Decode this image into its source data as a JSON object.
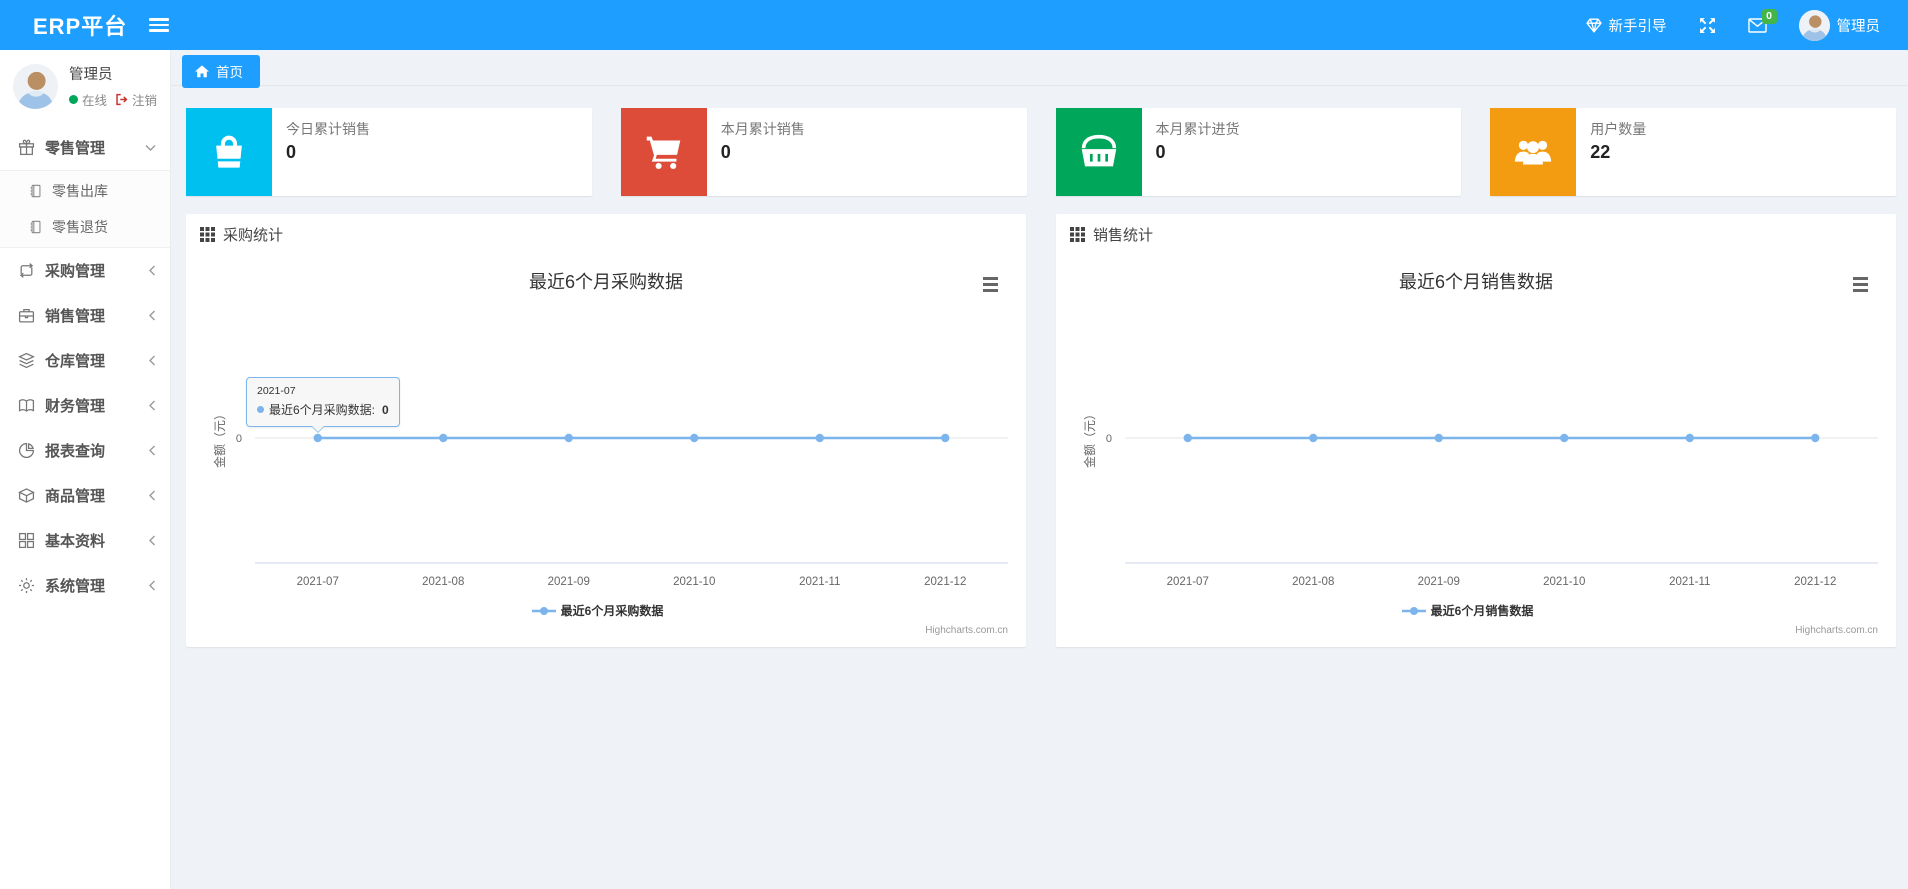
{
  "colors": {
    "accent": "#1e9fff",
    "badge_green": "#44b549",
    "series_blue": "#7cb5ec"
  },
  "navbar": {
    "brand": "ERP平台",
    "guide_label": "新手引导",
    "mail_badge": "0",
    "user_label": "管理员"
  },
  "sidebar": {
    "user": {
      "name": "管理员",
      "status": "在线",
      "logout_label": "注销"
    },
    "items": [
      {
        "label": "零售管理",
        "icon": "gift-icon",
        "expanded": true,
        "children": [
          {
            "label": "零售出库"
          },
          {
            "label": "零售退货"
          }
        ]
      },
      {
        "label": "采购管理",
        "icon": "loop-icon"
      },
      {
        "label": "销售管理",
        "icon": "briefcase-icon"
      },
      {
        "label": "仓库管理",
        "icon": "layers-icon"
      },
      {
        "label": "财务管理",
        "icon": "book-icon"
      },
      {
        "label": "报表查询",
        "icon": "pie-chart-icon"
      },
      {
        "label": "商品管理",
        "icon": "box-icon"
      },
      {
        "label": "基本资料",
        "icon": "grid-icon"
      },
      {
        "label": "系统管理",
        "icon": "gear-icon"
      }
    ]
  },
  "tabs": [
    {
      "label": "首页"
    }
  ],
  "cards": [
    {
      "label": "今日累计销售",
      "value": "0",
      "color": "#00c0ef",
      "icon": "shopping-bag-icon"
    },
    {
      "label": "本月累计销售",
      "value": "0",
      "color": "#dd4b39",
      "icon": "cart-icon"
    },
    {
      "label": "本月累计进货",
      "value": "0",
      "color": "#00a65a",
      "icon": "basket-icon"
    },
    {
      "label": "用户数量",
      "value": "22",
      "color": "#f39c12",
      "icon": "users-icon"
    }
  ],
  "panels": [
    {
      "title": "采购统计"
    },
    {
      "title": "销售统计"
    }
  ],
  "chart_data": [
    {
      "type": "line",
      "title": "最近6个月采购数据",
      "categories": [
        "2021-07",
        "2021-08",
        "2021-09",
        "2021-10",
        "2021-11",
        "2021-12"
      ],
      "series": [
        {
          "name": "最近6个月采购数据",
          "values": [
            0,
            0,
            0,
            0,
            0,
            0
          ]
        }
      ],
      "xlabel": "",
      "ylabel": "金额（元）",
      "ylim": [
        -1,
        1
      ],
      "y_ticks": [
        "0"
      ],
      "grid": "zero-line-only",
      "legend_position": "bottom",
      "color": "#7cb5ec",
      "credits": "Highcharts.com.cn",
      "tooltip": {
        "category": "2021-07",
        "label": "最近6个月采购数据:",
        "value": "0"
      }
    },
    {
      "type": "line",
      "title": "最近6个月销售数据",
      "categories": [
        "2021-07",
        "2021-08",
        "2021-09",
        "2021-10",
        "2021-11",
        "2021-12"
      ],
      "series": [
        {
          "name": "最近6个月销售数据",
          "values": [
            0,
            0,
            0,
            0,
            0,
            0
          ]
        }
      ],
      "xlabel": "",
      "ylabel": "金额（元）",
      "ylim": [
        -1,
        1
      ],
      "y_ticks": [
        "0"
      ],
      "grid": "zero-line-only",
      "legend_position": "bottom",
      "color": "#7cb5ec",
      "credits": "Highcharts.com.cn"
    }
  ]
}
